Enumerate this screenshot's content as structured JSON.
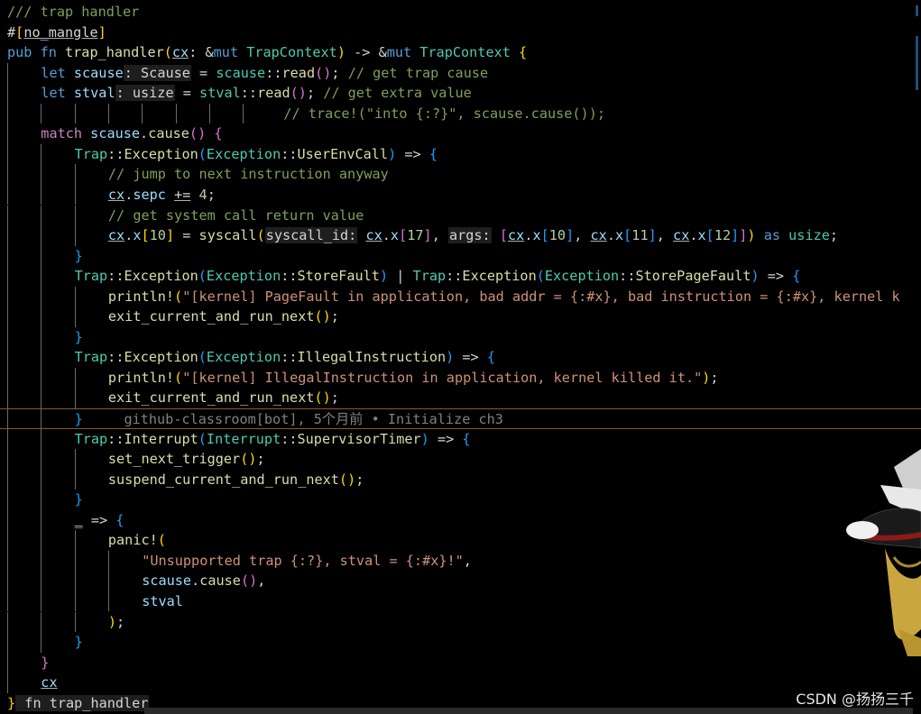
{
  "editor": {
    "lines": [
      {
        "indent": 0,
        "tokens": [
          {
            "t": "/// trap handler",
            "c": "c-com"
          }
        ]
      },
      {
        "indent": 0,
        "tokens": [
          {
            "t": "#",
            "c": "c-attr"
          },
          {
            "t": "[",
            "c": "c-br1"
          },
          {
            "t": "no_mangle",
            "c": "c-attr",
            "u": true
          },
          {
            "t": "]",
            "c": "c-br1"
          }
        ]
      },
      {
        "indent": 0,
        "tokens": [
          {
            "t": "pub ",
            "c": "c-kw"
          },
          {
            "t": "fn ",
            "c": "c-kw"
          },
          {
            "t": "trap_handler",
            "c": "c-fn"
          },
          {
            "t": "(",
            "c": "c-br1"
          },
          {
            "t": "cx",
            "c": "c-var",
            "u": true
          },
          {
            "t": ": ",
            "c": "c-op"
          },
          {
            "t": "&",
            "c": "c-op"
          },
          {
            "t": "mut ",
            "c": "c-kw"
          },
          {
            "t": "TrapContext",
            "c": "c-ty"
          },
          {
            "t": ")",
            "c": "c-br1"
          },
          {
            "t": " -> ",
            "c": "c-op"
          },
          {
            "t": "&",
            "c": "c-op"
          },
          {
            "t": "mut ",
            "c": "c-kw"
          },
          {
            "t": "TrapContext",
            "c": "c-ty"
          },
          {
            "t": " {",
            "c": "c-br1"
          }
        ]
      },
      {
        "indent": 1,
        "tokens": [
          {
            "t": "let ",
            "c": "c-kw"
          },
          {
            "t": "scause",
            "c": "c-var"
          },
          {
            "t": ": Scause",
            "c": "c-ty",
            "hint": true
          },
          {
            "t": " = ",
            "c": "c-op"
          },
          {
            "t": "scause",
            "c": "c-ty"
          },
          {
            "t": "::",
            "c": "c-op"
          },
          {
            "t": "read",
            "c": "c-fn"
          },
          {
            "t": "()",
            "c": "c-br2"
          },
          {
            "t": "; ",
            "c": "c-op"
          },
          {
            "t": "// get trap cause",
            "c": "c-com"
          }
        ]
      },
      {
        "indent": 1,
        "tokens": [
          {
            "t": "let ",
            "c": "c-kw"
          },
          {
            "t": "stval",
            "c": "c-var"
          },
          {
            "t": ": usize",
            "c": "c-ty",
            "hint": true
          },
          {
            "t": " = ",
            "c": "c-op"
          },
          {
            "t": "stval",
            "c": "c-ty"
          },
          {
            "t": "::",
            "c": "c-op"
          },
          {
            "t": "read",
            "c": "c-fn"
          },
          {
            "t": "()",
            "c": "c-br2"
          },
          {
            "t": "; ",
            "c": "c-op"
          },
          {
            "t": "// get extra value",
            "c": "c-com"
          }
        ]
      },
      {
        "indent": 8,
        "pad": " ",
        "tokens": [
          {
            "t": "// trace!(\"into {:?}\", scause.cause());",
            "c": "c-com"
          }
        ]
      },
      {
        "indent": 1,
        "tokens": [
          {
            "t": "match ",
            "c": "c-ctl"
          },
          {
            "t": "scause",
            "c": "c-var"
          },
          {
            "t": ".",
            "c": "c-op"
          },
          {
            "t": "cause",
            "c": "c-fn"
          },
          {
            "t": "()",
            "c": "c-br2"
          },
          {
            "t": " {",
            "c": "c-br2"
          }
        ]
      },
      {
        "indent": 2,
        "tokens": [
          {
            "t": "Trap",
            "c": "c-ty"
          },
          {
            "t": "::",
            "c": "c-op"
          },
          {
            "t": "Exception",
            "c": "c-fn"
          },
          {
            "t": "(",
            "c": "c-br3"
          },
          {
            "t": "Exception",
            "c": "c-ty"
          },
          {
            "t": "::",
            "c": "c-op"
          },
          {
            "t": "UserEnvCall",
            "c": "c-fn"
          },
          {
            "t": ")",
            "c": "c-br3"
          },
          {
            "t": " => ",
            "c": "c-op"
          },
          {
            "t": "{",
            "c": "c-br3"
          }
        ]
      },
      {
        "indent": 3,
        "tokens": [
          {
            "t": "// jump to next instruction anyway",
            "c": "c-com"
          }
        ]
      },
      {
        "indent": 3,
        "tokens": [
          {
            "t": "cx",
            "c": "c-var",
            "u": true
          },
          {
            "t": ".",
            "c": "c-op"
          },
          {
            "t": "sepc",
            "c": "c-var"
          },
          {
            "t": " ",
            "c": "c-op"
          },
          {
            "t": "+=",
            "c": "c-op",
            "u": true
          },
          {
            "t": " ",
            "c": "c-op"
          },
          {
            "t": "4",
            "c": "c-num"
          },
          {
            "t": ";",
            "c": "c-op"
          }
        ]
      },
      {
        "indent": 3,
        "tokens": [
          {
            "t": "// get system call return value",
            "c": "c-com"
          }
        ]
      },
      {
        "indent": 3,
        "tokens": [
          {
            "t": "cx",
            "c": "c-var",
            "u": true
          },
          {
            "t": ".",
            "c": "c-op"
          },
          {
            "t": "x",
            "c": "c-var"
          },
          {
            "t": "[",
            "c": "c-br1"
          },
          {
            "t": "10",
            "c": "c-num"
          },
          {
            "t": "]",
            "c": "c-br1"
          },
          {
            "t": " = ",
            "c": "c-op"
          },
          {
            "t": "syscall",
            "c": "c-fn"
          },
          {
            "t": "(",
            "c": "c-br1"
          },
          {
            "t": "syscall_id:",
            "c": "c-var",
            "hint": true
          },
          {
            "t": " ",
            "c": "c-op"
          },
          {
            "t": "cx",
            "c": "c-var",
            "u": true
          },
          {
            "t": ".",
            "c": "c-op"
          },
          {
            "t": "x",
            "c": "c-var"
          },
          {
            "t": "[",
            "c": "c-br2"
          },
          {
            "t": "17",
            "c": "c-num"
          },
          {
            "t": "]",
            "c": "c-br2"
          },
          {
            "t": ", ",
            "c": "c-op"
          },
          {
            "t": "args:",
            "c": "c-var",
            "hint": true
          },
          {
            "t": " ",
            "c": "c-op"
          },
          {
            "t": "[",
            "c": "c-br2"
          },
          {
            "t": "cx",
            "c": "c-var",
            "u": true
          },
          {
            "t": ".",
            "c": "c-op"
          },
          {
            "t": "x",
            "c": "c-var"
          },
          {
            "t": "[",
            "c": "c-br3"
          },
          {
            "t": "10",
            "c": "c-num"
          },
          {
            "t": "]",
            "c": "c-br3"
          },
          {
            "t": ", ",
            "c": "c-op"
          },
          {
            "t": "cx",
            "c": "c-var",
            "u": true
          },
          {
            "t": ".",
            "c": "c-op"
          },
          {
            "t": "x",
            "c": "c-var"
          },
          {
            "t": "[",
            "c": "c-br3"
          },
          {
            "t": "11",
            "c": "c-num"
          },
          {
            "t": "]",
            "c": "c-br3"
          },
          {
            "t": ", ",
            "c": "c-op"
          },
          {
            "t": "cx",
            "c": "c-var",
            "u": true
          },
          {
            "t": ".",
            "c": "c-op"
          },
          {
            "t": "x",
            "c": "c-var"
          },
          {
            "t": "[",
            "c": "c-br3"
          },
          {
            "t": "12",
            "c": "c-num"
          },
          {
            "t": "]",
            "c": "c-br3"
          },
          {
            "t": "]",
            "c": "c-br2"
          },
          {
            "t": ")",
            "c": "c-br1"
          },
          {
            "t": " as ",
            "c": "c-kw"
          },
          {
            "t": "usize",
            "c": "c-ty"
          },
          {
            "t": ";",
            "c": "c-op"
          }
        ]
      },
      {
        "indent": 2,
        "tokens": [
          {
            "t": "}",
            "c": "c-br3"
          }
        ]
      },
      {
        "indent": 2,
        "tokens": [
          {
            "t": "Trap",
            "c": "c-ty"
          },
          {
            "t": "::",
            "c": "c-op"
          },
          {
            "t": "Exception",
            "c": "c-fn"
          },
          {
            "t": "(",
            "c": "c-br3"
          },
          {
            "t": "Exception",
            "c": "c-ty"
          },
          {
            "t": "::",
            "c": "c-op"
          },
          {
            "t": "StoreFault",
            "c": "c-fn"
          },
          {
            "t": ")",
            "c": "c-br3"
          },
          {
            "t": " | ",
            "c": "c-op"
          },
          {
            "t": "Trap",
            "c": "c-ty"
          },
          {
            "t": "::",
            "c": "c-op"
          },
          {
            "t": "Exception",
            "c": "c-fn"
          },
          {
            "t": "(",
            "c": "c-br3"
          },
          {
            "t": "Exception",
            "c": "c-ty"
          },
          {
            "t": "::",
            "c": "c-op"
          },
          {
            "t": "StorePageFault",
            "c": "c-fn"
          },
          {
            "t": ")",
            "c": "c-br3"
          },
          {
            "t": " => ",
            "c": "c-op"
          },
          {
            "t": "{",
            "c": "c-br3"
          }
        ]
      },
      {
        "indent": 3,
        "tokens": [
          {
            "t": "println!",
            "c": "c-mac"
          },
          {
            "t": "(",
            "c": "c-br1"
          },
          {
            "t": "\"[kernel] PageFault in application, bad addr = {:#x}, bad instruction = {:#x}, kernel k",
            "c": "c-str"
          }
        ]
      },
      {
        "indent": 3,
        "tokens": [
          {
            "t": "exit_current_and_run_next",
            "c": "c-fn"
          },
          {
            "t": "()",
            "c": "c-br1"
          },
          {
            "t": ";",
            "c": "c-op"
          }
        ]
      },
      {
        "indent": 2,
        "tokens": [
          {
            "t": "}",
            "c": "c-br3"
          }
        ]
      },
      {
        "indent": 2,
        "tokens": [
          {
            "t": "Trap",
            "c": "c-ty"
          },
          {
            "t": "::",
            "c": "c-op"
          },
          {
            "t": "Exception",
            "c": "c-fn"
          },
          {
            "t": "(",
            "c": "c-br3"
          },
          {
            "t": "Exception",
            "c": "c-ty"
          },
          {
            "t": "::",
            "c": "c-op"
          },
          {
            "t": "IllegalInstruction",
            "c": "c-fn"
          },
          {
            "t": ")",
            "c": "c-br3"
          },
          {
            "t": " => ",
            "c": "c-op"
          },
          {
            "t": "{",
            "c": "c-br3"
          }
        ]
      },
      {
        "indent": 3,
        "tokens": [
          {
            "t": "println!",
            "c": "c-mac"
          },
          {
            "t": "(",
            "c": "c-br1"
          },
          {
            "t": "\"[kernel] IllegalInstruction in application, kernel killed it.\"",
            "c": "c-str"
          },
          {
            "t": ")",
            "c": "c-br1"
          },
          {
            "t": ";",
            "c": "c-op"
          }
        ]
      },
      {
        "indent": 3,
        "tokens": [
          {
            "t": "exit_current_and_run_next",
            "c": "c-fn"
          },
          {
            "t": "()",
            "c": "c-br1"
          },
          {
            "t": ";",
            "c": "c-op"
          }
        ]
      },
      {
        "indent": 2,
        "blame": true,
        "tokens": [
          {
            "t": "}",
            "c": "c-br3"
          },
          {
            "t": "     github-classroom[bot], 5个月前 • Initialize ch3",
            "c": "blame"
          }
        ]
      },
      {
        "indent": 2,
        "tokens": [
          {
            "t": "Trap",
            "c": "c-ty"
          },
          {
            "t": "::",
            "c": "c-op"
          },
          {
            "t": "Interrupt",
            "c": "c-fn"
          },
          {
            "t": "(",
            "c": "c-br3"
          },
          {
            "t": "Interrupt",
            "c": "c-ty"
          },
          {
            "t": "::",
            "c": "c-op"
          },
          {
            "t": "SupervisorTimer",
            "c": "c-fn"
          },
          {
            "t": ")",
            "c": "c-br3"
          },
          {
            "t": " => ",
            "c": "c-op"
          },
          {
            "t": "{",
            "c": "c-br3"
          }
        ]
      },
      {
        "indent": 3,
        "tokens": [
          {
            "t": "set_next_trigger",
            "c": "c-fn"
          },
          {
            "t": "()",
            "c": "c-br1"
          },
          {
            "t": ";",
            "c": "c-op"
          }
        ]
      },
      {
        "indent": 3,
        "tokens": [
          {
            "t": "suspend_current_and_run_next",
            "c": "c-fn"
          },
          {
            "t": "()",
            "c": "c-br1"
          },
          {
            "t": ";",
            "c": "c-op"
          }
        ]
      },
      {
        "indent": 2,
        "tokens": [
          {
            "t": "}",
            "c": "c-br3"
          }
        ]
      },
      {
        "indent": 2,
        "tokens": [
          {
            "t": "_",
            "c": "c-var",
            "u": true
          },
          {
            "t": " => ",
            "c": "c-op"
          },
          {
            "t": "{",
            "c": "c-br3"
          }
        ]
      },
      {
        "indent": 3,
        "tokens": [
          {
            "t": "panic!",
            "c": "c-mac"
          },
          {
            "t": "(",
            "c": "c-br1"
          }
        ]
      },
      {
        "indent": 4,
        "tokens": [
          {
            "t": "\"Unsupported trap {:?}, stval = {:#x}!\"",
            "c": "c-str"
          },
          {
            "t": ",",
            "c": "c-op"
          }
        ]
      },
      {
        "indent": 4,
        "tokens": [
          {
            "t": "scause",
            "c": "c-var"
          },
          {
            "t": ".",
            "c": "c-op"
          },
          {
            "t": "cause",
            "c": "c-fn"
          },
          {
            "t": "()",
            "c": "c-br2"
          },
          {
            "t": ",",
            "c": "c-op"
          }
        ]
      },
      {
        "indent": 4,
        "tokens": [
          {
            "t": "stval",
            "c": "c-var"
          }
        ]
      },
      {
        "indent": 3,
        "tokens": [
          {
            "t": ")",
            "c": "c-br1"
          },
          {
            "t": ";",
            "c": "c-op"
          }
        ]
      },
      {
        "indent": 2,
        "tokens": [
          {
            "t": "}",
            "c": "c-br3"
          }
        ]
      },
      {
        "indent": 1,
        "tokens": [
          {
            "t": "}",
            "c": "c-br2"
          }
        ]
      },
      {
        "indent": 1,
        "tokens": [
          {
            "t": "cx",
            "c": "c-var",
            "u": true
          }
        ]
      },
      {
        "indent": 0,
        "tokens": [
          {
            "t": "}",
            "c": "c-br1"
          },
          {
            "t": " fn trap_handler",
            "c": "c-op",
            "hint": true
          }
        ]
      }
    ]
  },
  "watermark": "CSDN @扬扬三千"
}
